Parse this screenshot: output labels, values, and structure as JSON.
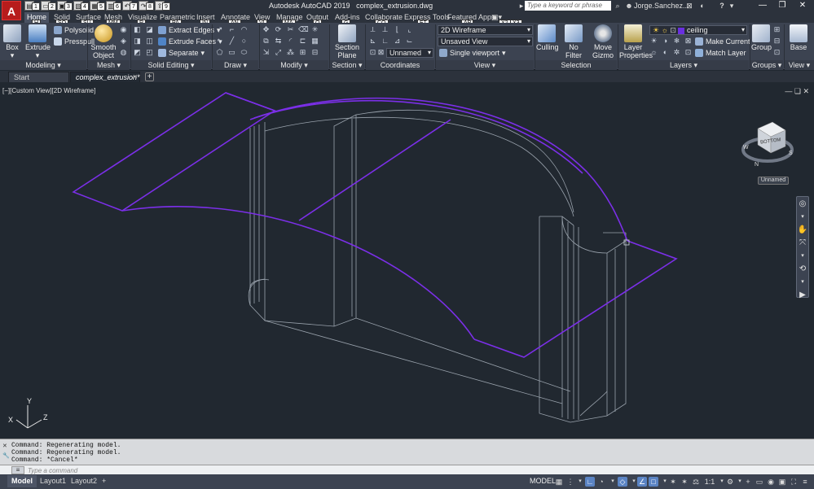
{
  "titlebar": {
    "app_logo": "A",
    "app_name": "Autodesk AutoCAD 2019",
    "file_name": "complex_extrusion.dwg",
    "quick_access": [
      "1",
      "2",
      "3",
      "4",
      "5",
      "6",
      "7",
      "8",
      "9"
    ],
    "search_placeholder": "Type a keyword or phrase",
    "user": "Jorge.Sanchez...",
    "help": "?",
    "window_controls": {
      "minimize": "—",
      "restore": "❐",
      "close": "✕"
    }
  },
  "ribbon_tabs": [
    {
      "label": "Home",
      "key": "H",
      "active": true
    },
    {
      "label": "Solid",
      "key": "SO"
    },
    {
      "label": "Surface",
      "key": "SU"
    },
    {
      "label": "Mesh",
      "key": "MM"
    },
    {
      "label": "Visualize",
      "key": "R"
    },
    {
      "label": "Parametric",
      "key": "PA"
    },
    {
      "label": "Insert",
      "key": "IN"
    },
    {
      "label": "Annotate",
      "key": "AN"
    },
    {
      "label": "View",
      "key": "VI"
    },
    {
      "label": "Manage",
      "key": "MA"
    },
    {
      "label": "Output",
      "key": "O"
    },
    {
      "label": "Add-ins",
      "key": "G"
    },
    {
      "label": "Collaborate",
      "key": "CO"
    },
    {
      "label": "Express Tools",
      "key": "ET"
    },
    {
      "label": "Featured Apps",
      "key": "AP"
    }
  ],
  "ribbon_extra_keys": [
    "X2",
    "X3"
  ],
  "ribbon": {
    "modeling": {
      "box": "Box",
      "extrude": "Extrude",
      "polysolid": "Polysolid",
      "presspull": "Presspull",
      "label": "Modeling"
    },
    "mesh": {
      "smooth_object": "Smooth Object",
      "label": "Mesh"
    },
    "solid_editing": {
      "extract_edges": "Extract Edges",
      "extrude_faces": "Extrude Faces",
      "separate": "Separate",
      "label": "Solid Editing"
    },
    "draw": {
      "label": "Draw"
    },
    "modify": {
      "label": "Modify"
    },
    "section": {
      "section_plane": "Section Plane",
      "label": "Section"
    },
    "coordinates": {
      "ucs": "Unnamed",
      "label": "Coordinates"
    },
    "view": {
      "visual_style": "2D Wireframe",
      "named_view": "Unsaved View",
      "viewport": "Single viewport",
      "label": "View"
    },
    "selection": {
      "culling": "Culling",
      "no_filter": "No Filter",
      "move_gizmo": "Move Gizmo",
      "label": "Selection"
    },
    "layers": {
      "layer_properties": "Layer Properties",
      "current_layer": "ceiling",
      "layer_color": "#6a2fe0",
      "make_current": "Make Current",
      "match_layer": "Match Layer",
      "label": "Layers"
    },
    "groups": {
      "group": "Group",
      "label": "Groups"
    },
    "view2": {
      "base": "Base",
      "label": "View"
    }
  },
  "doc_tabs": [
    {
      "label": "Start",
      "active": false
    },
    {
      "label": "complex_extrusion*",
      "active": true
    }
  ],
  "new_tab": "+",
  "viewport": {
    "label": "[−][Custom View][2D Wireframe]",
    "controls": "— ❏ ✕",
    "viewcube_face": "BOTTOM",
    "compass": {
      "s": "S",
      "w": "W",
      "n": "N"
    },
    "wcs_menu": "Unnamed",
    "highlight_color": "#7b2fe8",
    "wire_color": "#9aa3ad",
    "ucs": {
      "x": "X",
      "y": "Y",
      "z": "Z"
    }
  },
  "command_line": {
    "history": [
      "Command:  Regenerating model.",
      "Command:  Regenerating model.",
      "Command: *Cancel*"
    ],
    "placeholder": "Type a command",
    "prompt_icon": "≡"
  },
  "layout_tabs": [
    {
      "label": "Model",
      "active": true
    },
    {
      "label": "Layout1",
      "active": false
    },
    {
      "label": "Layout2",
      "active": false
    }
  ],
  "add_layout": "+",
  "status_bar": {
    "model": "MODEL",
    "scale": "1:1"
  }
}
